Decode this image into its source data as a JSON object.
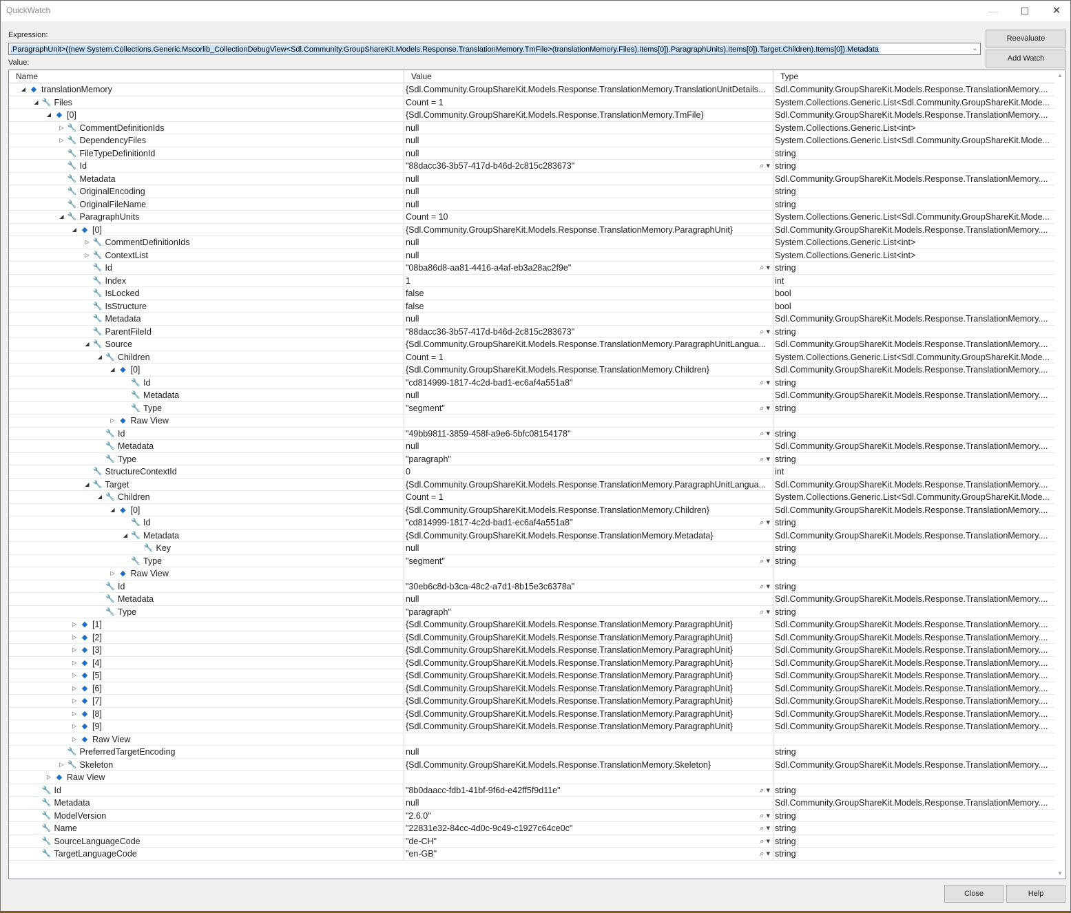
{
  "window": {
    "title": "QuickWatch"
  },
  "expression": {
    "label": "Expression:",
    "value": ".ParagraphUnit>((new System.Collections.Generic.Mscorlib_CollectionDebugView<Sdl.Community.GroupShareKit.Models.Response.TranslationMemory.TmFile>(translationMemory.Files).Items[0]).ParagraphUnits).Items[0]).Target.Children).Items[0]).Metadata"
  },
  "value_label": "Value:",
  "buttons": {
    "reevaluate": "Reevaluate",
    "add_watch": "Add Watch",
    "close": "Close",
    "help": "Help"
  },
  "columns": {
    "name": "Name",
    "value": "Value",
    "type": "Type"
  },
  "icons": {
    "wrench": "wrench-icon",
    "cube": "object-cube-icon",
    "magnifier": "magnifier-icon"
  },
  "rows": [
    {
      "d": 0,
      "exp": "open",
      "icon": "cube",
      "name": "translationMemory",
      "value": "{Sdl.Community.GroupShareKit.Models.Response.TranslationMemory.TranslationUnitDetails...",
      "type": "Sdl.Community.GroupShareKit.Models.Response.TranslationMemory....",
      "mag": false
    },
    {
      "d": 1,
      "exp": "open",
      "icon": "wrench",
      "name": "Files",
      "value": "Count = 1",
      "type": "System.Collections.Generic.List<Sdl.Community.GroupShareKit.Mode...",
      "mag": false
    },
    {
      "d": 2,
      "exp": "open",
      "icon": "cube",
      "name": "[0]",
      "value": "{Sdl.Community.GroupShareKit.Models.Response.TranslationMemory.TmFile}",
      "type": "Sdl.Community.GroupShareKit.Models.Response.TranslationMemory....",
      "mag": false
    },
    {
      "d": 3,
      "exp": "closed",
      "icon": "wrench",
      "name": "CommentDefinitionIds",
      "value": "null",
      "type": "System.Collections.Generic.List<int>",
      "mag": false
    },
    {
      "d": 3,
      "exp": "closed",
      "icon": "wrench",
      "name": "DependencyFiles",
      "value": "null",
      "type": "System.Collections.Generic.List<Sdl.Community.GroupShareKit.Mode...",
      "mag": false
    },
    {
      "d": 3,
      "exp": "",
      "icon": "wrench",
      "name": "FileTypeDefinitionId",
      "value": "null",
      "type": "string",
      "mag": false
    },
    {
      "d": 3,
      "exp": "",
      "icon": "wrench",
      "name": "Id",
      "value": "\"88dacc36-3b57-417d-b46d-2c815c283673\"",
      "type": "string",
      "mag": true
    },
    {
      "d": 3,
      "exp": "",
      "icon": "wrench",
      "name": "Metadata",
      "value": "null",
      "type": "Sdl.Community.GroupShareKit.Models.Response.TranslationMemory....",
      "mag": false
    },
    {
      "d": 3,
      "exp": "",
      "icon": "wrench",
      "name": "OriginalEncoding",
      "value": "null",
      "type": "string",
      "mag": false
    },
    {
      "d": 3,
      "exp": "",
      "icon": "wrench",
      "name": "OriginalFileName",
      "value": "null",
      "type": "string",
      "mag": false
    },
    {
      "d": 3,
      "exp": "open",
      "icon": "wrench",
      "name": "ParagraphUnits",
      "value": "Count = 10",
      "type": "System.Collections.Generic.List<Sdl.Community.GroupShareKit.Mode...",
      "mag": false
    },
    {
      "d": 4,
      "exp": "open",
      "icon": "cube",
      "name": "[0]",
      "value": "{Sdl.Community.GroupShareKit.Models.Response.TranslationMemory.ParagraphUnit}",
      "type": "Sdl.Community.GroupShareKit.Models.Response.TranslationMemory....",
      "mag": false
    },
    {
      "d": 5,
      "exp": "closed",
      "icon": "wrench",
      "name": "CommentDefinitionIds",
      "value": "null",
      "type": "System.Collections.Generic.List<int>",
      "mag": false
    },
    {
      "d": 5,
      "exp": "closed",
      "icon": "wrench",
      "name": "ContextList",
      "value": "null",
      "type": "System.Collections.Generic.List<int>",
      "mag": false
    },
    {
      "d": 5,
      "exp": "",
      "icon": "wrench",
      "name": "Id",
      "value": "\"08ba86d8-aa81-4416-a4af-eb3a28ac2f9e\"",
      "type": "string",
      "mag": true
    },
    {
      "d": 5,
      "exp": "",
      "icon": "wrench",
      "name": "Index",
      "value": "1",
      "type": "int",
      "mag": false
    },
    {
      "d": 5,
      "exp": "",
      "icon": "wrench",
      "name": "IsLocked",
      "value": "false",
      "type": "bool",
      "mag": false
    },
    {
      "d": 5,
      "exp": "",
      "icon": "wrench",
      "name": "IsStructure",
      "value": "false",
      "type": "bool",
      "mag": false
    },
    {
      "d": 5,
      "exp": "",
      "icon": "wrench",
      "name": "Metadata",
      "value": "null",
      "type": "Sdl.Community.GroupShareKit.Models.Response.TranslationMemory....",
      "mag": false
    },
    {
      "d": 5,
      "exp": "",
      "icon": "wrench",
      "name": "ParentFileId",
      "value": "\"88dacc36-3b57-417d-b46d-2c815c283673\"",
      "type": "string",
      "mag": true
    },
    {
      "d": 5,
      "exp": "open",
      "icon": "wrench",
      "name": "Source",
      "value": "{Sdl.Community.GroupShareKit.Models.Response.TranslationMemory.ParagraphUnitLangua...",
      "type": "Sdl.Community.GroupShareKit.Models.Response.TranslationMemory....",
      "mag": false
    },
    {
      "d": 6,
      "exp": "open",
      "icon": "wrench",
      "name": "Children",
      "value": "Count = 1",
      "type": "System.Collections.Generic.List<Sdl.Community.GroupShareKit.Mode...",
      "mag": false
    },
    {
      "d": 7,
      "exp": "open",
      "icon": "cube",
      "name": "[0]",
      "value": "{Sdl.Community.GroupShareKit.Models.Response.TranslationMemory.Children}",
      "type": "Sdl.Community.GroupShareKit.Models.Response.TranslationMemory....",
      "mag": false
    },
    {
      "d": 8,
      "exp": "",
      "icon": "wrench",
      "name": "Id",
      "value": "\"cd814999-1817-4c2d-bad1-ec6af4a551a8\"",
      "type": "string",
      "mag": true
    },
    {
      "d": 8,
      "exp": "",
      "icon": "wrench",
      "name": "Metadata",
      "value": "null",
      "type": "Sdl.Community.GroupShareKit.Models.Response.TranslationMemory....",
      "mag": false
    },
    {
      "d": 8,
      "exp": "",
      "icon": "wrench",
      "name": "Type",
      "value": "\"segment\"",
      "type": "string",
      "mag": true
    },
    {
      "d": 7,
      "exp": "closed",
      "icon": "cube",
      "name": "Raw View",
      "value": "",
      "type": "",
      "mag": false
    },
    {
      "d": 6,
      "exp": "",
      "icon": "wrench",
      "name": "Id",
      "value": "\"49bb9811-3859-458f-a9e6-5bfc08154178\"",
      "type": "string",
      "mag": true
    },
    {
      "d": 6,
      "exp": "",
      "icon": "wrench",
      "name": "Metadata",
      "value": "null",
      "type": "Sdl.Community.GroupShareKit.Models.Response.TranslationMemory....",
      "mag": false
    },
    {
      "d": 6,
      "exp": "",
      "icon": "wrench",
      "name": "Type",
      "value": "\"paragraph\"",
      "type": "string",
      "mag": true
    },
    {
      "d": 5,
      "exp": "",
      "icon": "wrench",
      "name": "StructureContextId",
      "value": "0",
      "type": "int",
      "mag": false
    },
    {
      "d": 5,
      "exp": "open",
      "icon": "wrench",
      "name": "Target",
      "value": "{Sdl.Community.GroupShareKit.Models.Response.TranslationMemory.ParagraphUnitLangua...",
      "type": "Sdl.Community.GroupShareKit.Models.Response.TranslationMemory....",
      "mag": false
    },
    {
      "d": 6,
      "exp": "open",
      "icon": "wrench",
      "name": "Children",
      "value": "Count = 1",
      "type": "System.Collections.Generic.List<Sdl.Community.GroupShareKit.Mode...",
      "mag": false
    },
    {
      "d": 7,
      "exp": "open",
      "icon": "cube",
      "name": "[0]",
      "value": "{Sdl.Community.GroupShareKit.Models.Response.TranslationMemory.Children}",
      "type": "Sdl.Community.GroupShareKit.Models.Response.TranslationMemory....",
      "mag": false
    },
    {
      "d": 8,
      "exp": "",
      "icon": "wrench",
      "name": "Id",
      "value": "\"cd814999-1817-4c2d-bad1-ec6af4a551a8\"",
      "type": "string",
      "mag": true
    },
    {
      "d": 8,
      "exp": "open",
      "icon": "wrench",
      "name": "Metadata",
      "value": "{Sdl.Community.GroupShareKit.Models.Response.TranslationMemory.Metadata}",
      "type": "Sdl.Community.GroupShareKit.Models.Response.TranslationMemory....",
      "mag": false
    },
    {
      "d": 9,
      "exp": "",
      "icon": "wrench",
      "name": "Key",
      "value": "null",
      "type": "string",
      "mag": false
    },
    {
      "d": 8,
      "exp": "",
      "icon": "wrench",
      "name": "Type",
      "value": "\"segment\"",
      "type": "string",
      "mag": true
    },
    {
      "d": 7,
      "exp": "closed",
      "icon": "cube",
      "name": "Raw View",
      "value": "",
      "type": "",
      "mag": false
    },
    {
      "d": 6,
      "exp": "",
      "icon": "wrench",
      "name": "Id",
      "value": "\"30eb6c8d-b3ca-48c2-a7d1-8b15e3c6378a\"",
      "type": "string",
      "mag": true
    },
    {
      "d": 6,
      "exp": "",
      "icon": "wrench",
      "name": "Metadata",
      "value": "null",
      "type": "Sdl.Community.GroupShareKit.Models.Response.TranslationMemory....",
      "mag": false
    },
    {
      "d": 6,
      "exp": "",
      "icon": "wrench",
      "name": "Type",
      "value": "\"paragraph\"",
      "type": "string",
      "mag": true
    },
    {
      "d": 4,
      "exp": "closed",
      "icon": "cube",
      "name": "[1]",
      "value": "{Sdl.Community.GroupShareKit.Models.Response.TranslationMemory.ParagraphUnit}",
      "type": "Sdl.Community.GroupShareKit.Models.Response.TranslationMemory....",
      "mag": false
    },
    {
      "d": 4,
      "exp": "closed",
      "icon": "cube",
      "name": "[2]",
      "value": "{Sdl.Community.GroupShareKit.Models.Response.TranslationMemory.ParagraphUnit}",
      "type": "Sdl.Community.GroupShareKit.Models.Response.TranslationMemory....",
      "mag": false
    },
    {
      "d": 4,
      "exp": "closed",
      "icon": "cube",
      "name": "[3]",
      "value": "{Sdl.Community.GroupShareKit.Models.Response.TranslationMemory.ParagraphUnit}",
      "type": "Sdl.Community.GroupShareKit.Models.Response.TranslationMemory....",
      "mag": false
    },
    {
      "d": 4,
      "exp": "closed",
      "icon": "cube",
      "name": "[4]",
      "value": "{Sdl.Community.GroupShareKit.Models.Response.TranslationMemory.ParagraphUnit}",
      "type": "Sdl.Community.GroupShareKit.Models.Response.TranslationMemory....",
      "mag": false
    },
    {
      "d": 4,
      "exp": "closed",
      "icon": "cube",
      "name": "[5]",
      "value": "{Sdl.Community.GroupShareKit.Models.Response.TranslationMemory.ParagraphUnit}",
      "type": "Sdl.Community.GroupShareKit.Models.Response.TranslationMemory....",
      "mag": false
    },
    {
      "d": 4,
      "exp": "closed",
      "icon": "cube",
      "name": "[6]",
      "value": "{Sdl.Community.GroupShareKit.Models.Response.TranslationMemory.ParagraphUnit}",
      "type": "Sdl.Community.GroupShareKit.Models.Response.TranslationMemory....",
      "mag": false
    },
    {
      "d": 4,
      "exp": "closed",
      "icon": "cube",
      "name": "[7]",
      "value": "{Sdl.Community.GroupShareKit.Models.Response.TranslationMemory.ParagraphUnit}",
      "type": "Sdl.Community.GroupShareKit.Models.Response.TranslationMemory....",
      "mag": false
    },
    {
      "d": 4,
      "exp": "closed",
      "icon": "cube",
      "name": "[8]",
      "value": "{Sdl.Community.GroupShareKit.Models.Response.TranslationMemory.ParagraphUnit}",
      "type": "Sdl.Community.GroupShareKit.Models.Response.TranslationMemory....",
      "mag": false
    },
    {
      "d": 4,
      "exp": "closed",
      "icon": "cube",
      "name": "[9]",
      "value": "{Sdl.Community.GroupShareKit.Models.Response.TranslationMemory.ParagraphUnit}",
      "type": "Sdl.Community.GroupShareKit.Models.Response.TranslationMemory....",
      "mag": false
    },
    {
      "d": 4,
      "exp": "closed",
      "icon": "cube",
      "name": "Raw View",
      "value": "",
      "type": "",
      "mag": false
    },
    {
      "d": 3,
      "exp": "",
      "icon": "wrench",
      "name": "PreferredTargetEncoding",
      "value": "null",
      "type": "string",
      "mag": false
    },
    {
      "d": 3,
      "exp": "closed",
      "icon": "wrench",
      "name": "Skeleton",
      "value": "{Sdl.Community.GroupShareKit.Models.Response.TranslationMemory.Skeleton}",
      "type": "Sdl.Community.GroupShareKit.Models.Response.TranslationMemory....",
      "mag": false
    },
    {
      "d": 2,
      "exp": "closed",
      "icon": "cube",
      "name": "Raw View",
      "value": "",
      "type": "",
      "mag": false
    },
    {
      "d": 1,
      "exp": "",
      "icon": "wrench",
      "name": "Id",
      "value": "\"8b0daacc-fdb1-41bf-9f6d-e42ff5f9d11e\"",
      "type": "string",
      "mag": true
    },
    {
      "d": 1,
      "exp": "",
      "icon": "wrench",
      "name": "Metadata",
      "value": "null",
      "type": "Sdl.Community.GroupShareKit.Models.Response.TranslationMemory....",
      "mag": false
    },
    {
      "d": 1,
      "exp": "",
      "icon": "wrench",
      "name": "ModelVersion",
      "value": "\"2.6.0\"",
      "type": "string",
      "mag": true
    },
    {
      "d": 1,
      "exp": "",
      "icon": "wrench",
      "name": "Name",
      "value": "\"22831e32-84cc-4d0c-9c49-c1927c64ce0c\"",
      "type": "string",
      "mag": true
    },
    {
      "d": 1,
      "exp": "",
      "icon": "wrench",
      "name": "SourceLanguageCode",
      "value": "\"de-CH\"",
      "type": "string",
      "mag": true
    },
    {
      "d": 1,
      "exp": "",
      "icon": "wrench",
      "name": "TargetLanguageCode",
      "value": "\"en-GB\"",
      "type": "string",
      "mag": true
    }
  ]
}
